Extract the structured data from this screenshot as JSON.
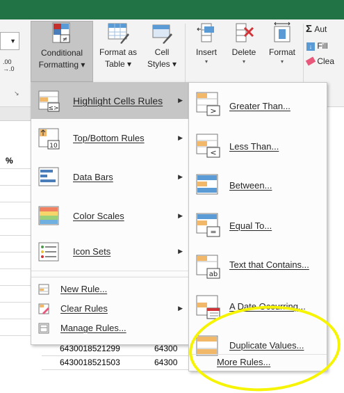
{
  "ribbon": {
    "buttons": {
      "conditional_formatting": [
        "Conditional",
        "Formatting ▾"
      ],
      "format_as_table": [
        "Format as",
        "Table ▾"
      ],
      "cell_styles": [
        "Cell",
        "Styles ▾"
      ],
      "insert": "Insert",
      "delete": "Delete",
      "format": "Format"
    },
    "number_fragment": ".00\n→.0",
    "autosum_label": "Aut",
    "fill_label": "Fill",
    "clear_label": "Clea",
    "launcher_glyph": "↘"
  },
  "menu_main": {
    "items": [
      {
        "label": "Highlight Cells Rules",
        "has_submenu": true,
        "highlighted": true
      },
      {
        "label": "Top/Bottom Rules",
        "has_submenu": true
      },
      {
        "label": "Data Bars",
        "has_submenu": true
      },
      {
        "label": "Color Scales",
        "has_submenu": true
      },
      {
        "label": "Icon Sets",
        "has_submenu": true
      },
      {
        "label": "New Rule...",
        "has_submenu": false
      },
      {
        "label": "Clear Rules",
        "has_submenu": true
      },
      {
        "label": "Manage Rules...",
        "has_submenu": false
      }
    ],
    "icon_text_topbottom": "10"
  },
  "menu_sub": {
    "items": [
      {
        "label": "Greater Than...",
        "icon_symbol": ">"
      },
      {
        "label": "Less Than...",
        "icon_symbol": "<"
      },
      {
        "label": "Between...",
        "icon_symbol": ""
      },
      {
        "label": "Equal To...",
        "icon_symbol": "="
      },
      {
        "label": "Text that Contains...",
        "icon_symbol": "ab"
      },
      {
        "label": "A Date Occurring...",
        "icon_symbol": ""
      },
      {
        "label": "Duplicate Values...",
        "icon_symbol": ""
      }
    ],
    "more_rules": "More Rules..."
  },
  "sheet": {
    "col_header_fragment": "%",
    "rows": [
      {
        "a": "6430018521299",
        "b": "64300"
      },
      {
        "a": "6430018521503",
        "b": "64300"
      }
    ]
  },
  "colors": {
    "title_band": "#217346",
    "menu_highlight": "#c6c6c6",
    "annotation": "#f6f400"
  }
}
